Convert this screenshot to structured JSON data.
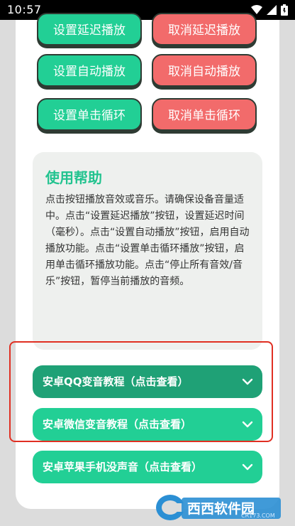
{
  "status": {
    "time": "10:57"
  },
  "buttons": {
    "set_delay": "设置延迟播放",
    "cancel_delay": "取消延迟播放",
    "set_auto": "设置自动播放",
    "cancel_auto": "取消自动播放",
    "set_loop": "设置单击循环",
    "cancel_loop": "取消单击循环"
  },
  "help": {
    "title": "使用帮助",
    "body": "点击按钮播放音效或音乐。请确保设备音量适中。点击“设置延迟播放”按钮，设置延迟时间（毫秒）。点击“设置自动播放”按钮，启用自动播放功能。点击“设置单击循环播放”按钮，启用单击循环播放功能。点击“停止所有音效/音乐”按钮，暂停当前播放的音频。"
  },
  "accordions": [
    {
      "label": "安卓QQ变音教程（点击查看）"
    },
    {
      "label": "安卓微信变音教程（点击查看）"
    },
    {
      "label": "安卓苹果手机没声音（点击查看）"
    }
  ],
  "watermark": {
    "text": "西西软件园",
    "site": "CR173.COM"
  },
  "colors": {
    "green": "#22cf95",
    "red": "#f26b6b",
    "dark_green": "#1fa176",
    "highlight": "#e02f22"
  }
}
